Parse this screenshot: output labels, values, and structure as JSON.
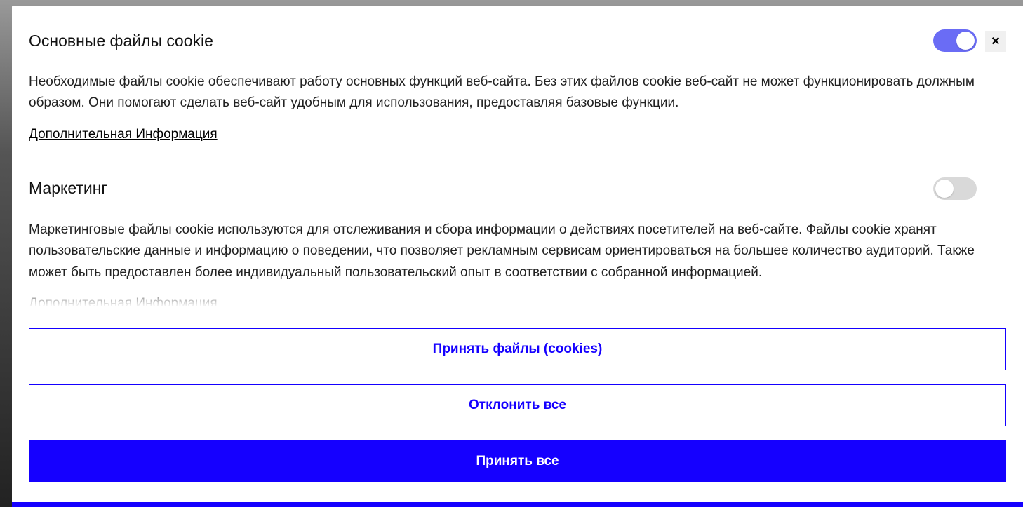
{
  "close_label": "✕",
  "sections": [
    {
      "title": "Основные файлы cookie",
      "desc": "Необходимые файлы cookie обеспечивают работу основных функций веб-сайта. Без этих файлов cookie веб-сайт не может функционировать должным образом. Они помогают сделать веб-сайт удобным для использования, предоставляя базовые функции.",
      "more": "Дополнительная Информация",
      "toggle_on": true
    },
    {
      "title": "Маркетинг",
      "desc": "Маркетинговые файлы cookie используются для отслеживания и сбора информации о действиях посетителей на веб-сайте. Файлы cookie хранят пользовательские данные и информацию о поведении, что позволяет рекламным сервисам ориентироваться на большее количество аудиторий. Также может быть предоставлен более индивидуальный пользовательский опыт в соответствии с собранной информацией.",
      "more": "Дополнительная Информация",
      "toggle_on": false
    }
  ],
  "footer": {
    "accept_selected": "Принять файлы (cookies)",
    "reject_all": "Отклонить все",
    "accept_all": "Принять все"
  }
}
